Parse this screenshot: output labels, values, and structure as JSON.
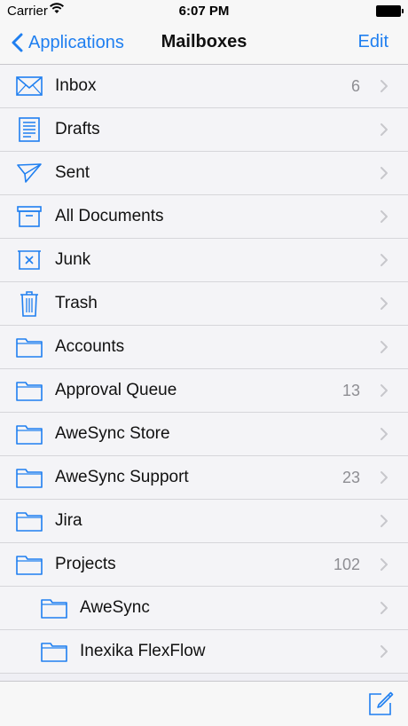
{
  "status_bar": {
    "carrier": "Carrier",
    "time": "6:07 PM"
  },
  "nav": {
    "back_label": "Applications",
    "title": "Mailboxes",
    "edit_label": "Edit"
  },
  "colors": {
    "accent": "#1f7ff0",
    "count": "#8e8e93",
    "chevron": "#c7c7cc"
  },
  "mailboxes": [
    {
      "label": "Inbox",
      "count": "6",
      "icon": "envelope-icon",
      "indent": 0
    },
    {
      "label": "Drafts",
      "count": "",
      "icon": "document-icon",
      "indent": 0
    },
    {
      "label": "Sent",
      "count": "",
      "icon": "paper-plane-icon",
      "indent": 0
    },
    {
      "label": "All Documents",
      "count": "",
      "icon": "archive-box-icon",
      "indent": 0
    },
    {
      "label": "Junk",
      "count": "",
      "icon": "junk-bin-icon",
      "indent": 0
    },
    {
      "label": "Trash",
      "count": "",
      "icon": "trash-can-icon",
      "indent": 0
    },
    {
      "label": "Accounts",
      "count": "",
      "icon": "folder-icon",
      "indent": 0
    },
    {
      "label": "Approval Queue",
      "count": "13",
      "icon": "folder-icon",
      "indent": 0
    },
    {
      "label": "AweSync Store",
      "count": "",
      "icon": "folder-icon",
      "indent": 0
    },
    {
      "label": "AweSync Support",
      "count": "23",
      "icon": "folder-icon",
      "indent": 0
    },
    {
      "label": "Jira",
      "count": "",
      "icon": "folder-icon",
      "indent": 0
    },
    {
      "label": "Projects",
      "count": "102",
      "icon": "folder-icon",
      "indent": 0
    },
    {
      "label": "AweSync",
      "count": "",
      "icon": "folder-icon",
      "indent": 1
    },
    {
      "label": "Inexika FlexFlow",
      "count": "",
      "icon": "folder-icon",
      "indent": 1
    }
  ],
  "toolbar": {
    "compose_icon": "compose-icon"
  }
}
